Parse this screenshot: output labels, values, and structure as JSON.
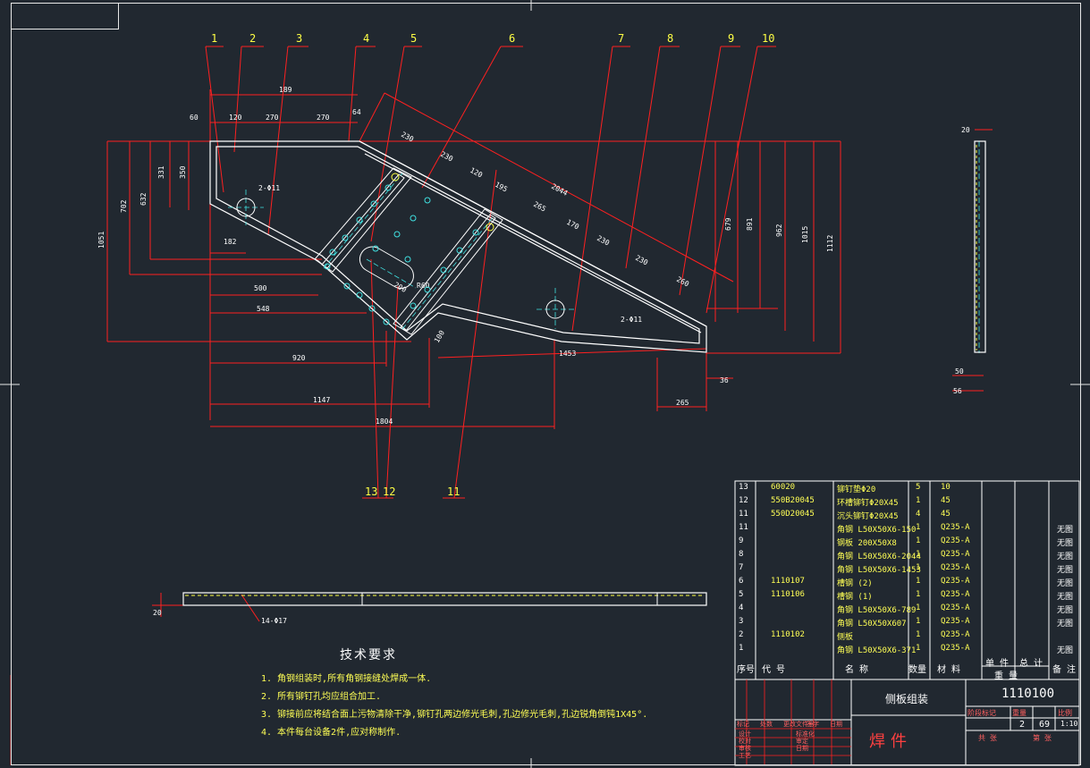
{
  "colors": {
    "background": "#212830",
    "dimension": "#ff2020",
    "part": "#ffffff",
    "text": "#ffff55",
    "green": "#40ff40",
    "cyan": "#40e0e0",
    "frame": "#e8e8e8"
  },
  "leaders": [
    "1",
    "2",
    "3",
    "4",
    "5",
    "6",
    "7",
    "8",
    "9",
    "10",
    "13",
    "12",
    "11"
  ],
  "dims": {
    "d189": "189",
    "d60": "60",
    "d120": "120",
    "d270a": "270",
    "d270b": "270",
    "d64": "64",
    "d230a": "230",
    "d230b": "230",
    "d120b": "120",
    "d195": "195",
    "d265": "265",
    "d2044": "2044",
    "d170": "170",
    "d230c": "230",
    "d230d": "230",
    "d260": "260",
    "d331": "331",
    "d350": "350",
    "d702": "702",
    "d632": "632",
    "d1051": "1051",
    "hole1": "2-Φ11",
    "d182": "182",
    "d500": "500",
    "d548": "548",
    "d920": "920",
    "d1147": "1147",
    "d1804": "1804",
    "d1453": "1453",
    "d36": "36",
    "d265b": "265",
    "hole2": "2-Φ11",
    "d679": "679",
    "d891": "891",
    "d962": "962",
    "d1015": "1015",
    "d1112": "1112",
    "r60": "R60",
    "d200": "200",
    "d100": "100",
    "side20": "20",
    "side50": "50",
    "side56": "56",
    "bot20": "20",
    "bot_holes": "14-Φ17"
  },
  "tech": {
    "title": "技术要求",
    "lines": [
      "1.  角钢组装时,所有角钢接缝处焊成一体.",
      "2.  所有铆钉孔均应组合加工.",
      "3.  铆接前应将结合面上污物清除干净,铆钉孔两边修光毛刺,孔边修光毛刺,孔边锐角倒钝1X45°.",
      "4.  本件每台设备2件,应对称制作."
    ]
  },
  "bom": {
    "rows": [
      {
        "no": "13",
        "code": "60020",
        "name": "铆钉垫Φ20",
        "qty": "5",
        "mat": "10",
        "note": ""
      },
      {
        "no": "12",
        "code": "550B20045",
        "name": "环槽铆钉Φ20X45",
        "qty": "1",
        "mat": "45",
        "note": ""
      },
      {
        "no": "11",
        "code": "550D20045",
        "name": "沉头铆钉Φ20X45",
        "qty": "4",
        "mat": "45",
        "note": ""
      },
      {
        "no": "11",
        "code": "",
        "name": "角钢 L50X50X6-150",
        "qty": "1",
        "mat": "Q235-A",
        "note": "无图"
      },
      {
        "no": "9",
        "code": "",
        "name": "钢板 200X50X8",
        "qty": "1",
        "mat": "Q235-A",
        "note": "无图"
      },
      {
        "no": "8",
        "code": "",
        "name": "角钢 L50X50X6-2044",
        "qty": "1",
        "mat": "Q235-A",
        "note": "无图"
      },
      {
        "no": "7",
        "code": "",
        "name": "角钢 L50X50X6-1453",
        "qty": "1",
        "mat": "Q235-A",
        "note": "无图"
      },
      {
        "no": "6",
        "code": "1110107",
        "name": "槽钢 (2)",
        "qty": "1",
        "mat": "Q235-A",
        "note": "无图"
      },
      {
        "no": "5",
        "code": "1110106",
        "name": "槽钢 (1)",
        "qty": "1",
        "mat": "Q235-A",
        "note": "无图"
      },
      {
        "no": "4",
        "code": "",
        "name": "角钢 L50X50X6-789",
        "qty": "1",
        "mat": "Q235-A",
        "note": "无图"
      },
      {
        "no": "3",
        "code": "",
        "name": "角钢 L50X50X607",
        "qty": "1",
        "mat": "Q235-A",
        "note": "无图"
      },
      {
        "no": "2",
        "code": "1110102",
        "name": "侧板",
        "qty": "1",
        "mat": "Q235-A",
        "note": ""
      },
      {
        "no": "1",
        "code": "",
        "name": "角钢 L50X50X6-371",
        "qty": "1",
        "mat": "Q235-A",
        "note": "无图"
      }
    ],
    "header": {
      "no": "序号",
      "code": "代  号",
      "name": "名  称",
      "qty": "数量",
      "mat": "材  料",
      "single": "单 件",
      "total": "总 计",
      "weight": "重  量",
      "note": "备 注"
    }
  },
  "title_block": {
    "drawing_name": "侧板组装",
    "drawing_no": "1110100",
    "stamp": "焊件",
    "stage": "阶段标记",
    "weight": "重量",
    "scale": "比例",
    "qty_val": "2",
    "weight_val": "69",
    "scale_val": "1:10",
    "sheet": "共  张",
    "sheet2": "第  张",
    "rows": [
      "标记",
      "处数",
      "更改文件号",
      "签字",
      "日期",
      "设计",
      "校对",
      "审核",
      "工艺",
      "标准化",
      "审定",
      "日期"
    ]
  }
}
